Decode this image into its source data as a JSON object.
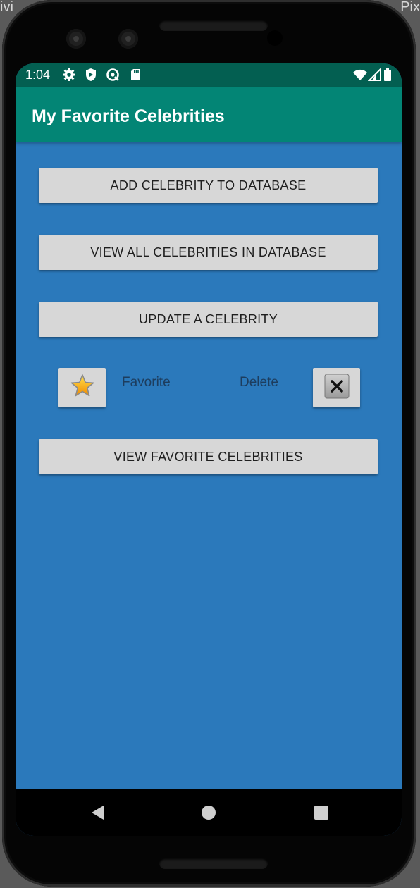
{
  "background": {
    "left_text": "ivi",
    "right_text": "Pix"
  },
  "status_bar": {
    "time": "1:04",
    "icons_left": [
      "settings-icon",
      "shield-icon",
      "sync-icon",
      "sd-card-icon"
    ],
    "icons_right": [
      "wifi-icon",
      "cell-signal-icon",
      "battery-icon"
    ]
  },
  "app_bar": {
    "title": "My Favorite Celebrities"
  },
  "buttons": {
    "add": "ADD CELEBRITY TO DATABASE",
    "view_all": "VIEW ALL CELEBRITIES IN DATABASE",
    "update": "UPDATE A CELEBRITY",
    "view_favorites": "VIEW FAVORITE CELEBRITIES"
  },
  "actions": {
    "favorite_label": "Favorite",
    "delete_label": "Delete",
    "favorite_icon": "star-icon",
    "delete_icon": "close-icon"
  },
  "nav_bar": {
    "icons": [
      "back-icon",
      "home-icon",
      "recents-icon"
    ]
  },
  "colors": {
    "status_bar": "#035f51",
    "app_bar": "#038575",
    "content_background": "#2b79bb",
    "button_background": "#d7d7d7"
  }
}
